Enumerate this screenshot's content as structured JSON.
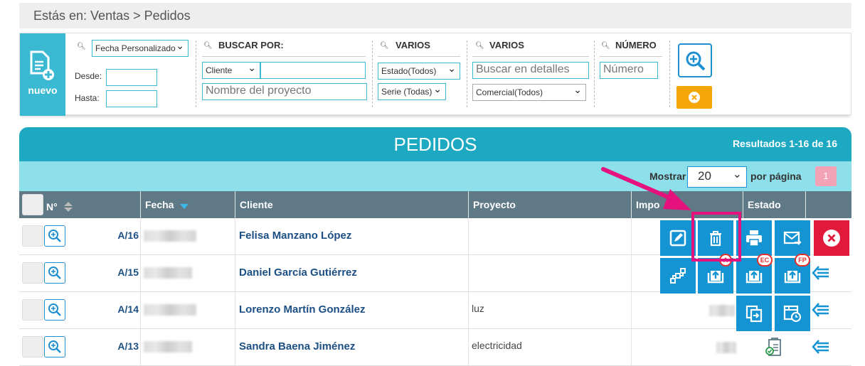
{
  "breadcrumb": "Estás en: Ventas > Pedidos",
  "new_button": {
    "label": "nuevo"
  },
  "filters": {
    "date_select": "Fecha Personalizado",
    "desde_label": "Desde:",
    "hasta_label": "Hasta:",
    "buscar_por_label": "BUSCAR POR:",
    "client_select": "Cliente",
    "project_placeholder": "Nombre del proyecto",
    "varios1_label": "VARIOS",
    "estado_select": "Estado(Todos)",
    "serie_select": "Serie (Todas)",
    "varios2_label": "VARIOS",
    "details_placeholder": "Buscar en detalles",
    "comercial_select": "Comercial(Todos)",
    "numero_label": "NÚMERO",
    "numero_placeholder": "Número"
  },
  "table": {
    "title": "PEDIDOS",
    "results": "Resultados 1-16 de 16",
    "show_label": "Mostrar",
    "per_page_value": "20",
    "per_page_label": "por página",
    "page": "1",
    "columns": [
      "N°",
      "Fecha",
      "Cliente",
      "Proyecto",
      "Importe",
      "Estado"
    ],
    "importe_visible": "Impo",
    "rows": [
      {
        "num": "A/16",
        "client": "Felisa Manzano López",
        "project": ""
      },
      {
        "num": "A/15",
        "client": "Daniel García Gutiérrez",
        "project": ""
      },
      {
        "num": "A/14",
        "client": "Lorenzo Martín González",
        "project": "luz"
      },
      {
        "num": "A/13",
        "client": "Sandra Baena Jiménez",
        "project": "electricidad"
      }
    ]
  },
  "actions": {
    "badges": [
      "A",
      "EC",
      "FP"
    ]
  },
  "icons": [
    "new-document-icon",
    "search-icon",
    "zoom-in-icon",
    "clear-icon",
    "edit-icon",
    "trash-icon",
    "print-icon",
    "email-icon",
    "close-icon",
    "flow-icon",
    "upload-icon",
    "copy-icon",
    "schedule-icon",
    "list-icon",
    "sort-icon"
  ],
  "colors": {
    "accent": "#1ea9c3",
    "action_blue": "#1594d4",
    "highlight": "#e5127d",
    "danger": "#e11a3b",
    "warning": "#f5a70a",
    "header_gray": "#5f7987"
  }
}
